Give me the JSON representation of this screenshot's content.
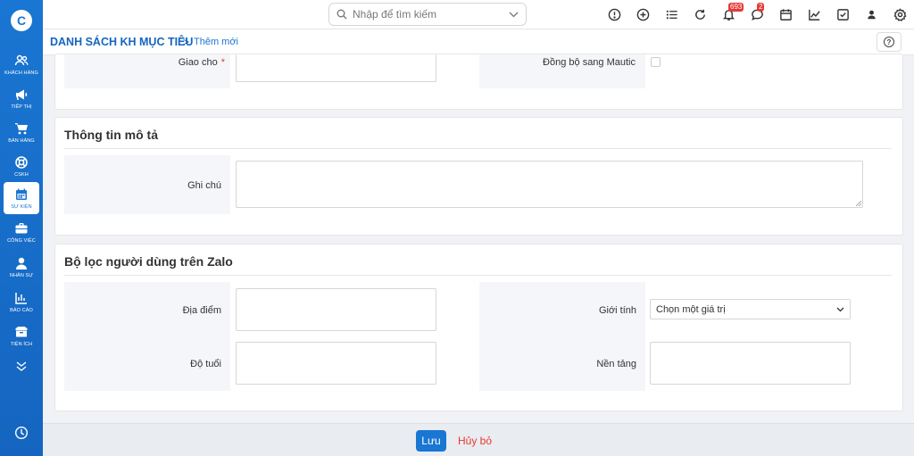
{
  "sidebar": {
    "logo": "C",
    "items": [
      {
        "label": "KHÁCH HÀNG",
        "icon": "users-icon"
      },
      {
        "label": "TIẾP THỊ",
        "icon": "megaphone-icon"
      },
      {
        "label": "BÁN HÀNG",
        "icon": "cart-icon"
      },
      {
        "label": "CSKH",
        "icon": "lifebuoy-icon"
      },
      {
        "label": "SỰ KIỆN",
        "icon": "calendar-icon",
        "active": true
      },
      {
        "label": "CÔNG VIỆC",
        "icon": "briefcase-icon"
      },
      {
        "label": "NHÂN SỰ",
        "icon": "person-icon"
      },
      {
        "label": "BÁO CÁO",
        "icon": "report-icon"
      },
      {
        "label": "TIỆN ÍCH",
        "icon": "box-icon"
      }
    ]
  },
  "topbar": {
    "search_placeholder": "Nhập để tìm kiếm",
    "notification_count": "693",
    "message_count": "2"
  },
  "breadcrumb": {
    "title": "DANH SÁCH KH MỤC TIÊU",
    "separator": ">",
    "current": "Thêm mới",
    "help": "?"
  },
  "form": {
    "assign_label": "Giao cho",
    "required_mark": "*",
    "mautic_label": "Đồng bộ sang Mautic",
    "section_description": "Thông tin mô tả",
    "note_label": "Ghi chú",
    "section_zalo": "Bộ lọc người dùng trên Zalo",
    "location_label": "Địa điểm",
    "gender_label": "Giới tính",
    "gender_value": "Chọn một giá trị",
    "age_label": "Độ tuổi",
    "platform_label": "Nền tảng"
  },
  "footer": {
    "save": "Lưu",
    "cancel": "Hủy bỏ"
  },
  "colors": {
    "primary": "#1976d2",
    "danger": "#e53935"
  }
}
